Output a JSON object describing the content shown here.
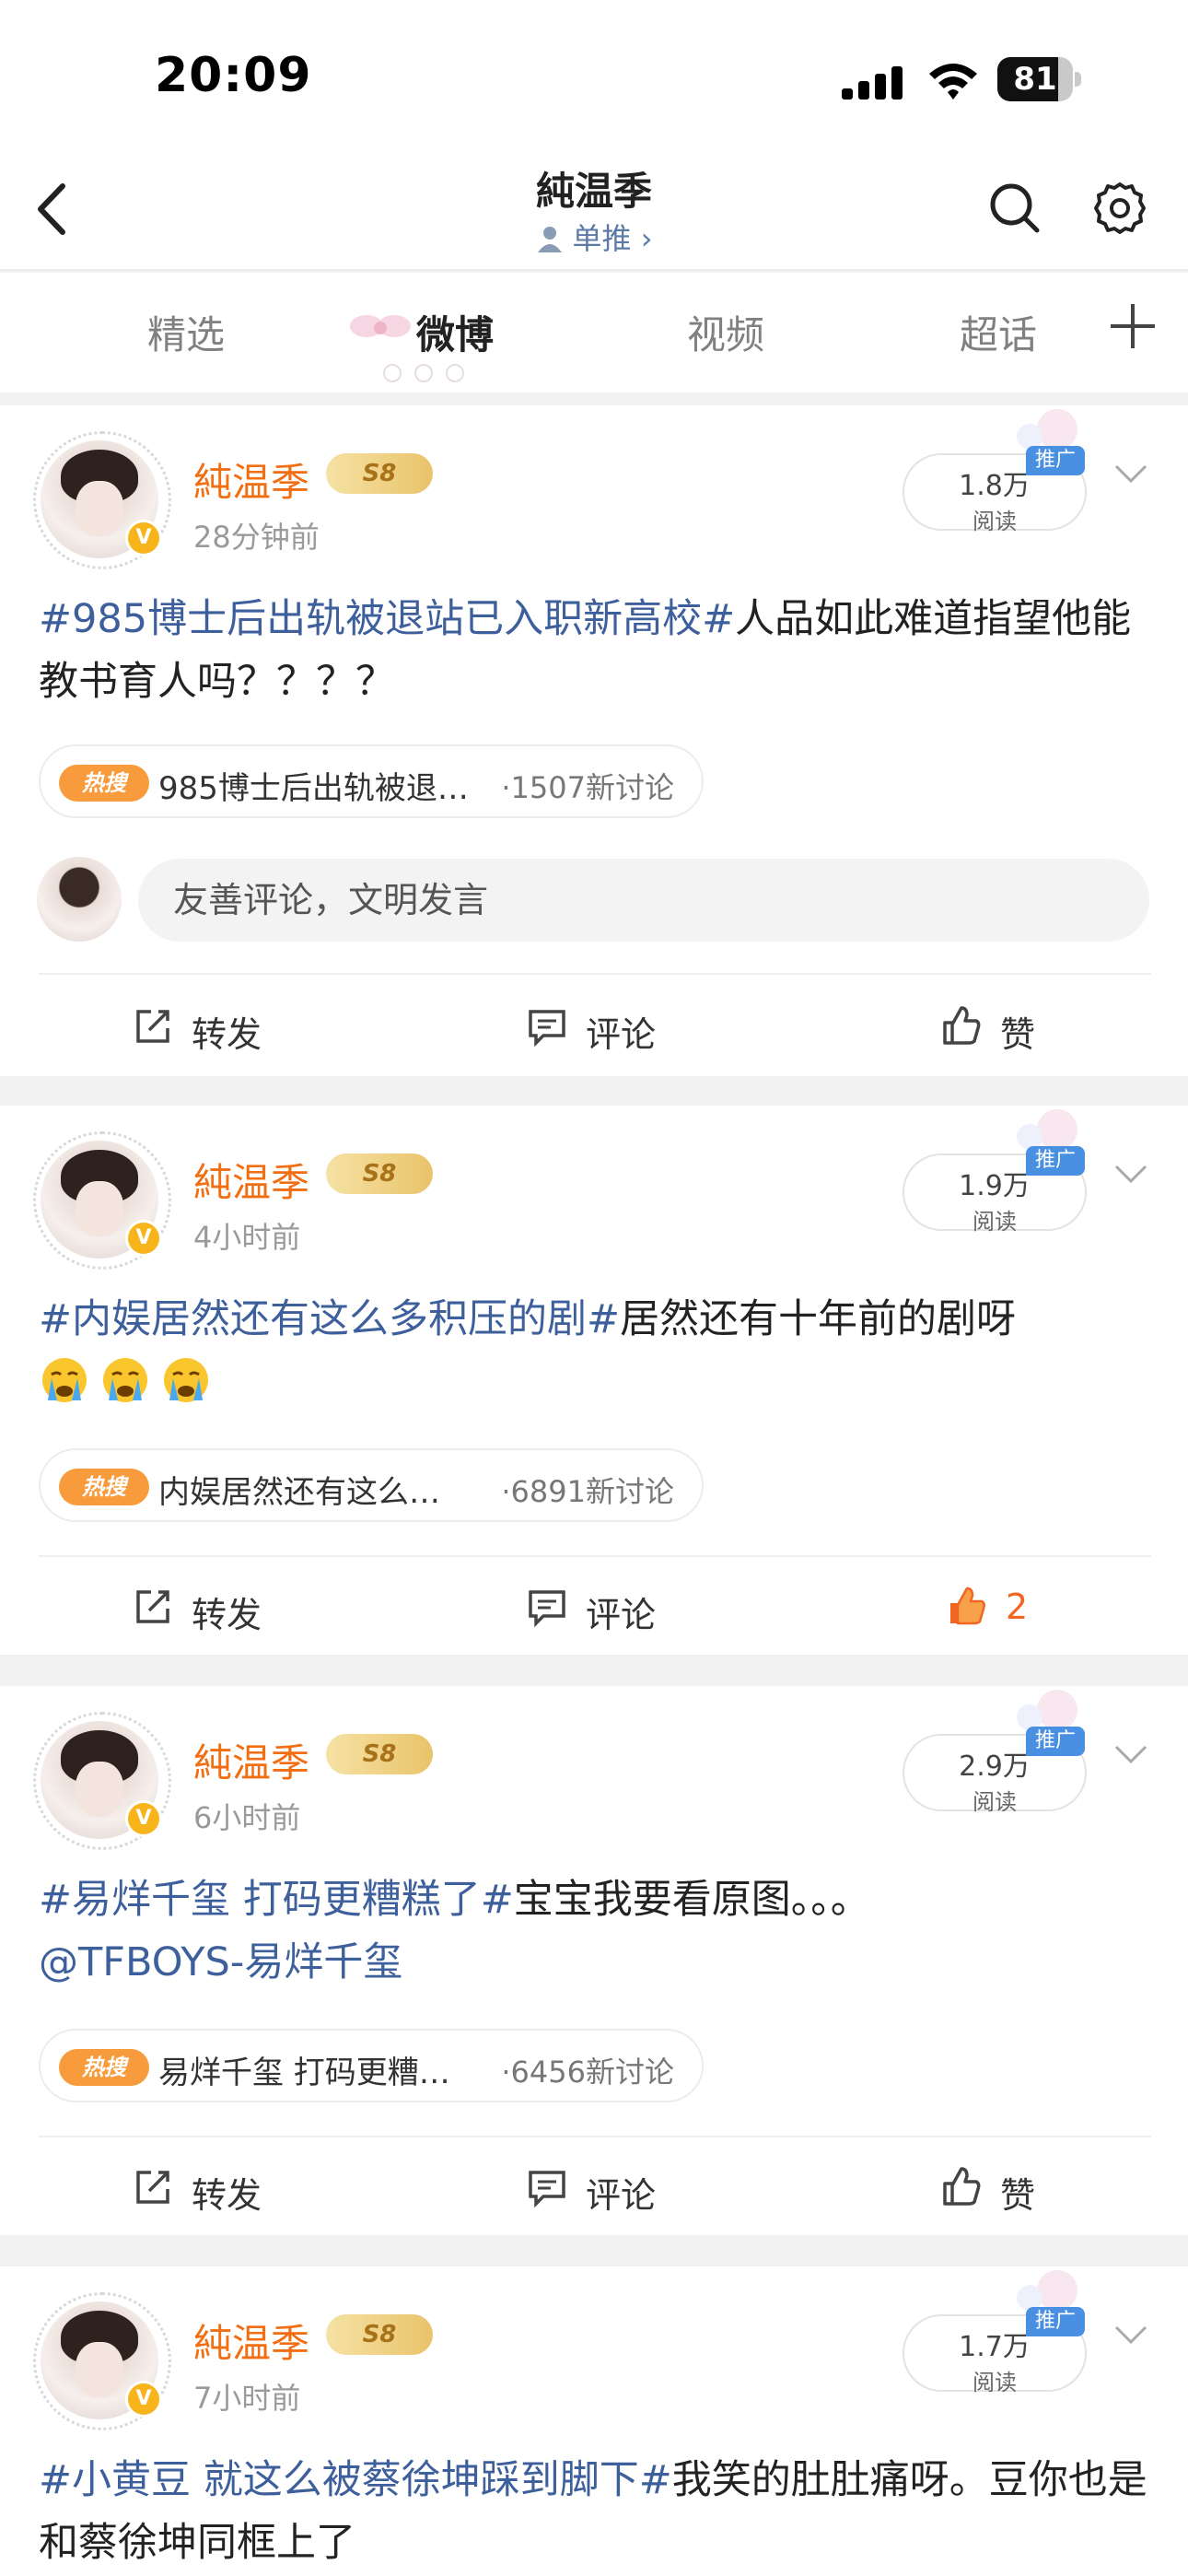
{
  "status_bar": {
    "time": "20:09",
    "battery_percent": "81",
    "battery_level": 0.81
  },
  "nav": {
    "title": "純温季",
    "subtitle": "单推"
  },
  "tabs": [
    {
      "label": "精选",
      "active": false
    },
    {
      "label": "微博",
      "active": true
    },
    {
      "label": "视频",
      "active": false
    },
    {
      "label": "超话",
      "active": false
    }
  ],
  "posts": [
    {
      "username": "純温季",
      "level": "S8",
      "time": "28分钟前",
      "reads": "1.8万",
      "reads_label": "阅读",
      "promo": "推广",
      "topic": "#985博士后出轨被退站已入职新高校#",
      "text": "人品如此难道指望他能教书育人吗？？？？",
      "hot_badge": "热搜",
      "hot_title": "985博士后出轨被退…",
      "hot_count": "·1507新讨论",
      "comment_placeholder": "友善评论，文明发言",
      "repost": "转发",
      "comment": "评论",
      "like": "赞"
    },
    {
      "username": "純温季",
      "level": "S8",
      "time": "4小时前",
      "reads": "1.9万",
      "reads_label": "阅读",
      "promo": "推广",
      "topic": "#内娱居然还有这么多积压的剧#",
      "text": "居然还有十年前的剧呀",
      "hot_badge": "热搜",
      "hot_title": "内娱居然还有这么…",
      "hot_count": "·6891新讨论",
      "repost": "转发",
      "comment": "评论",
      "like": "2"
    },
    {
      "username": "純温季",
      "level": "S8",
      "time": "6小时前",
      "reads": "2.9万",
      "reads_label": "阅读",
      "promo": "推广",
      "topic": "#易烊千玺 打码更糟糕了#",
      "text": "宝宝我要看原图。。。",
      "mention": "@TFBOYS-易烊千玺",
      "hot_badge": "热搜",
      "hot_title": "易烊千玺 打码更糟…",
      "hot_count": "·6456新讨论",
      "repost": "转发",
      "comment": "评论",
      "like": "赞"
    },
    {
      "username": "純温季",
      "level": "S8",
      "time": "7小时前",
      "reads": "1.7万",
      "reads_label": "阅读",
      "promo": "推广",
      "topic": "#小黄豆 就这么被蔡徐坤踩到脚下#",
      "text": "我笑的肚肚痛呀。豆你也是和蔡徐坤同框上了"
    }
  ],
  "colors": {
    "accent_orange": "#f26e13",
    "topic_blue": "#3d5f9b",
    "hot_orange": "#f79b3c",
    "like_active": "#f26522"
  },
  "icons": [
    "back-arrow-icon",
    "search-icon",
    "gear-icon",
    "plus-icon",
    "repost-icon",
    "comment-icon",
    "like-icon",
    "cry-emoji-icon",
    "verified-badge-icon"
  ]
}
